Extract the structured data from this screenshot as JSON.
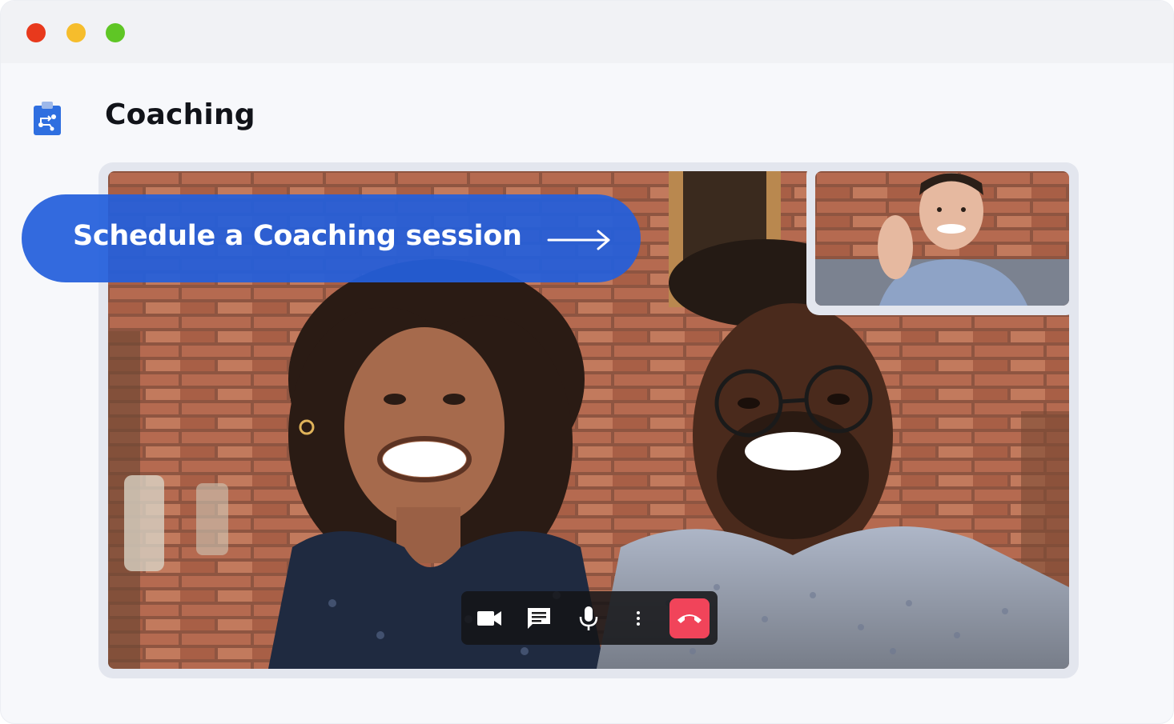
{
  "window": {
    "controls": [
      "close",
      "minimize",
      "maximize"
    ],
    "colors": {
      "close": "#e8391c",
      "minimize": "#f6bd2c",
      "maximize": "#5fc625"
    }
  },
  "app": {
    "title": "Coaching",
    "icon": "clipboard-flow-icon"
  },
  "cta": {
    "label": "Schedule a Coaching session",
    "icon": "arrow-right-icon",
    "color": "#235fdc"
  },
  "call": {
    "main_video": "group-participants-video",
    "self_view": "coach-participant-video",
    "controls": [
      {
        "name": "camera",
        "icon": "video-camera-icon"
      },
      {
        "name": "chat",
        "icon": "chat-bubble-icon"
      },
      {
        "name": "microphone",
        "icon": "microphone-icon"
      },
      {
        "name": "more",
        "icon": "more-vertical-icon"
      },
      {
        "name": "end-call",
        "icon": "phone-hangup-icon",
        "color": "#f1445a"
      }
    ]
  }
}
